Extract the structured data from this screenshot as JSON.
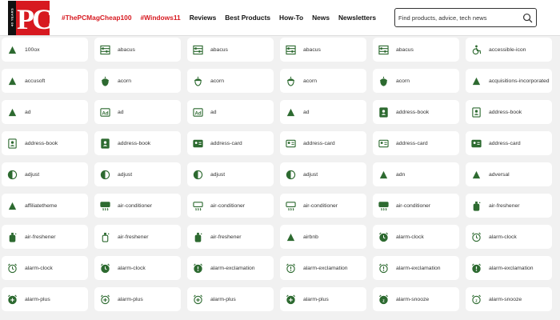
{
  "header": {
    "logo_text": "PC",
    "logo_years": "40 YEARS",
    "nav": [
      {
        "label": "#ThePCMagCheap100",
        "accent": true
      },
      {
        "label": "#Windows11",
        "accent": true
      },
      {
        "label": "Reviews",
        "accent": false
      },
      {
        "label": "Best Products",
        "accent": false
      },
      {
        "label": "How-To",
        "accent": false
      },
      {
        "label": "News",
        "accent": false
      },
      {
        "label": "Newsletters",
        "accent": false
      }
    ],
    "search_placeholder": "Find products, advice, tech news"
  },
  "colors": {
    "brand_red": "#d71920",
    "icon_green": "#2d6a30"
  },
  "icons": [
    {
      "name": "100ox",
      "icon": "brand"
    },
    {
      "name": "abacus",
      "icon": "abacus"
    },
    {
      "name": "abacus",
      "icon": "abacus-alt"
    },
    {
      "name": "abacus",
      "icon": "abacus-dots"
    },
    {
      "name": "abacus",
      "icon": "abacus-outline"
    },
    {
      "name": "accessible-icon",
      "icon": "wheelchair"
    },
    {
      "name": "accusoft",
      "icon": "brand"
    },
    {
      "name": "acorn",
      "icon": "acorn"
    },
    {
      "name": "acorn",
      "icon": "acorn-outline"
    },
    {
      "name": "acorn",
      "icon": "acorn-outline"
    },
    {
      "name": "acorn",
      "icon": "acorn"
    },
    {
      "name": "acquisitions-incorporated",
      "icon": "brand"
    },
    {
      "name": "ad",
      "icon": "ad-solid"
    },
    {
      "name": "ad",
      "icon": "ad-outline"
    },
    {
      "name": "ad",
      "icon": "ad-outline"
    },
    {
      "name": "ad",
      "icon": "ad-solid"
    },
    {
      "name": "address-book",
      "icon": "address-book"
    },
    {
      "name": "address-book",
      "icon": "address-book-outline"
    },
    {
      "name": "address-book",
      "icon": "address-book-outline"
    },
    {
      "name": "address-book",
      "icon": "address-book"
    },
    {
      "name": "address-card",
      "icon": "address-card"
    },
    {
      "name": "address-card",
      "icon": "address-card-outline"
    },
    {
      "name": "address-card",
      "icon": "address-card-outline"
    },
    {
      "name": "address-card",
      "icon": "address-card"
    },
    {
      "name": "adjust",
      "icon": "adjust"
    },
    {
      "name": "adjust",
      "icon": "adjust"
    },
    {
      "name": "adjust",
      "icon": "adjust-outline"
    },
    {
      "name": "adjust",
      "icon": "adjust"
    },
    {
      "name": "adn",
      "icon": "brand"
    },
    {
      "name": "adversal",
      "icon": "brand"
    },
    {
      "name": "affiliatetheme",
      "icon": "brand"
    },
    {
      "name": "air-conditioner",
      "icon": "air-conditioner"
    },
    {
      "name": "air-conditioner",
      "icon": "air-conditioner-outline"
    },
    {
      "name": "air-conditioner",
      "icon": "air-conditioner-outline"
    },
    {
      "name": "air-conditioner",
      "icon": "air-conditioner"
    },
    {
      "name": "air-freshener",
      "icon": "air-freshener"
    },
    {
      "name": "air-freshener",
      "icon": "air-freshener"
    },
    {
      "name": "air-freshener",
      "icon": "air-freshener-outline"
    },
    {
      "name": "air-freshener",
      "icon": "air-freshener"
    },
    {
      "name": "airbnb",
      "icon": "brand"
    },
    {
      "name": "alarm-clock",
      "icon": "alarm-clock"
    },
    {
      "name": "alarm-clock",
      "icon": "alarm-clock-outline"
    },
    {
      "name": "alarm-clock",
      "icon": "alarm-clock-outline"
    },
    {
      "name": "alarm-clock",
      "icon": "alarm-clock"
    },
    {
      "name": "alarm-exclamation",
      "icon": "alarm-exclamation"
    },
    {
      "name": "alarm-exclamation",
      "icon": "alarm-exclamation-outline"
    },
    {
      "name": "alarm-exclamation",
      "icon": "alarm-exclamation-outline"
    },
    {
      "name": "alarm-exclamation",
      "icon": "alarm-exclamation"
    },
    {
      "name": "alarm-plus",
      "icon": "alarm-plus"
    },
    {
      "name": "alarm-plus",
      "icon": "alarm-plus-outline"
    },
    {
      "name": "alarm-plus",
      "icon": "alarm-plus-outline"
    },
    {
      "name": "alarm-plus",
      "icon": "alarm-plus"
    },
    {
      "name": "alarm-snooze",
      "icon": "alarm-snooze"
    },
    {
      "name": "alarm-snooze",
      "icon": "alarm-snooze-outline"
    }
  ]
}
